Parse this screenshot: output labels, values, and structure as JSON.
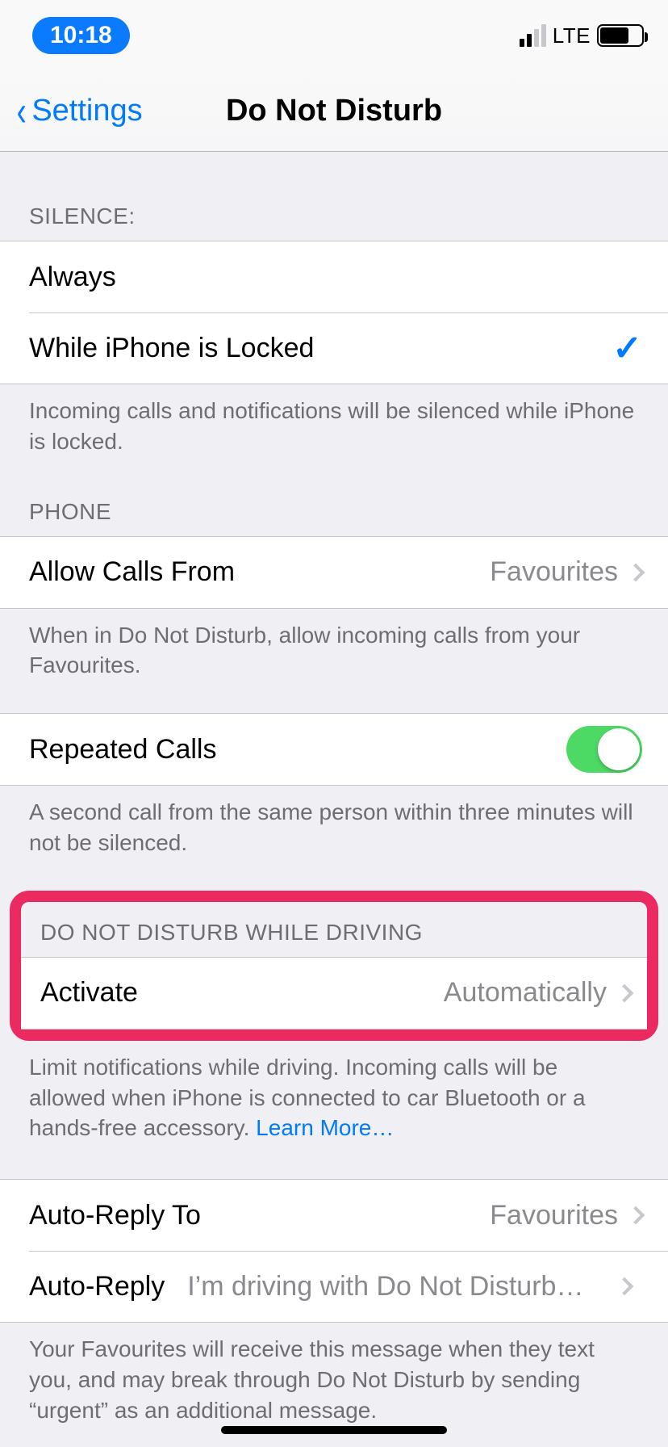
{
  "statusbar": {
    "time": "10:18",
    "network": "LTE"
  },
  "nav": {
    "back": "Settings",
    "title": "Do Not Disturb"
  },
  "sections": {
    "silence": {
      "header": "Silence:",
      "option_always": "Always",
      "option_locked": "While iPhone is Locked",
      "footer": "Incoming calls and notifications will be silenced while iPhone is locked."
    },
    "phone": {
      "header": "Phone",
      "allow_calls_label": "Allow Calls From",
      "allow_calls_value": "Favourites",
      "allow_calls_footer": "When in Do Not Disturb, allow incoming calls from your Favourites.",
      "repeated_label": "Repeated Calls",
      "repeated_on": true,
      "repeated_footer": "A second call from the same person within three minutes will not be silenced."
    },
    "driving": {
      "header": "Do Not Disturb While Driving",
      "activate_label": "Activate",
      "activate_value": "Automatically",
      "footer_text": "Limit notifications while driving. Incoming calls will be allowed when iPhone is connected to car Bluetooth or a hands-free accessory. ",
      "learn_more": "Learn More…",
      "auto_reply_to_label": "Auto-Reply To",
      "auto_reply_to_value": "Favourites",
      "auto_reply_label": "Auto-Reply",
      "auto_reply_value": "I’m driving with Do Not Disturb…",
      "auto_reply_footer": "Your Favourites will receive this message when they text you, and may break through Do Not Disturb by sending “urgent” as an additional message."
    }
  }
}
